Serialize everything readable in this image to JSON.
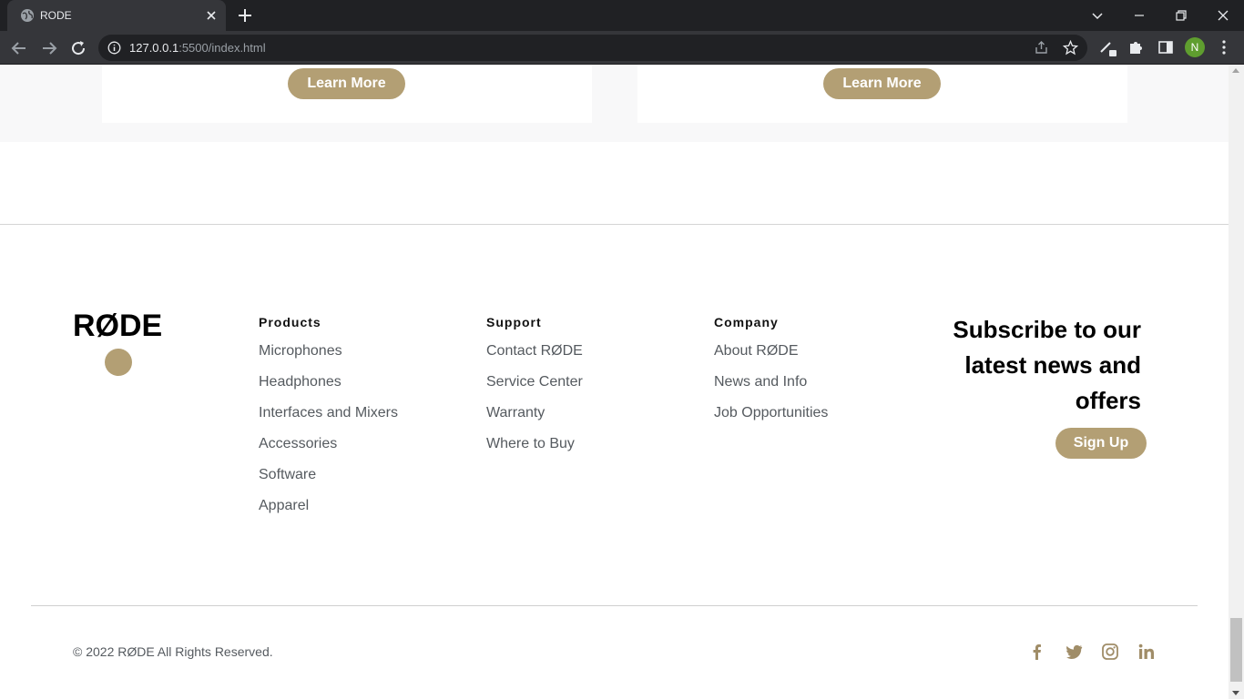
{
  "browser": {
    "tab_title": "RODE",
    "url_host": "127.0.0.1",
    "url_rest": ":5500/index.html",
    "avatar_letter": "N"
  },
  "cards": [
    {
      "button_label": "Learn More"
    },
    {
      "button_label": "Learn More"
    }
  ],
  "footer": {
    "logo_text": "RØDE",
    "columns": [
      {
        "heading": "Products",
        "links": [
          "Microphones",
          "Headphones",
          "Interfaces and Mixers",
          "Accessories",
          "Software",
          "Apparel"
        ]
      },
      {
        "heading": "Support",
        "links": [
          "Contact RØDE",
          "Service Center",
          "Warranty",
          "Where to Buy"
        ]
      },
      {
        "heading": "Company",
        "links": [
          "About RØDE",
          "News and Info",
          "Job Opportunities"
        ]
      }
    ],
    "subscribe": {
      "line1": "Subscribe to our",
      "line2": "latest news and",
      "line3": "offers",
      "button_label": "Sign Up"
    },
    "copyright": "© 2022 RØDE All Rights Reserved.",
    "social_icons": [
      "facebook-icon",
      "twitter-icon",
      "instagram-icon",
      "linkedin-icon"
    ]
  },
  "colors": {
    "accent": "#b39f74",
    "chrome_dark": "#202124",
    "chrome_toolbar": "#35363a",
    "band_bg": "#f8f8f9"
  }
}
